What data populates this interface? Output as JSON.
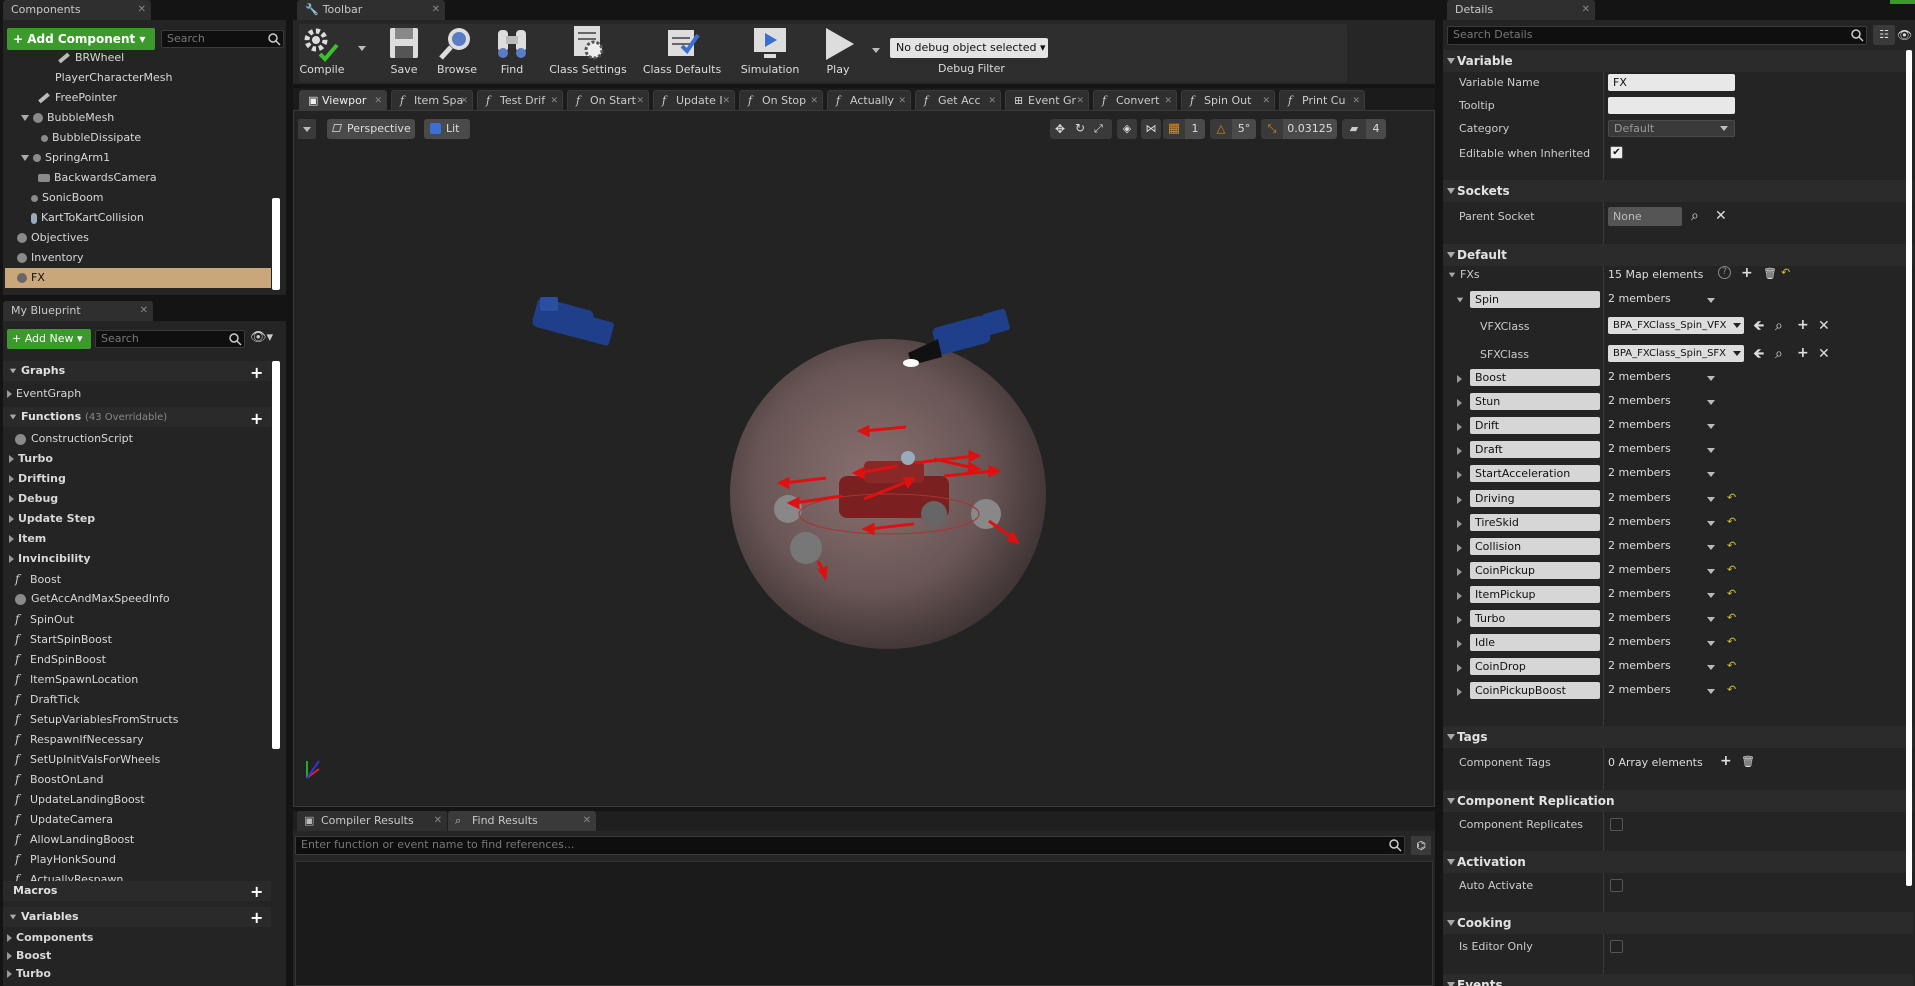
{
  "components": {
    "tab_title": "Components",
    "add_component_label": "+ Add Component ▾",
    "search_placeholder": "Search",
    "items": [
      {
        "label": "BRWheel"
      },
      {
        "label": "PlayerCharacterMesh"
      },
      {
        "label": "FreePointer"
      },
      {
        "label": "BubbleMesh"
      },
      {
        "label": "BubbleDissipate"
      },
      {
        "label": "SpringArm1"
      },
      {
        "label": "BackwardsCamera"
      },
      {
        "label": "SonicBoom"
      },
      {
        "label": "KartToKartCollision"
      },
      {
        "label": "Objectives"
      },
      {
        "label": "Inventory"
      },
      {
        "label": "FX"
      }
    ]
  },
  "my_blueprint": {
    "tab_title": "My Blueprint",
    "add_new_label": "+ Add New ▾",
    "search_placeholder": "Search",
    "graphs_label": "Graphs",
    "event_graph": "EventGraph",
    "functions_label": "Functions",
    "functions_overridable": "(43 Overridable)",
    "functions": [
      {
        "label": "ConstructionScript",
        "kind": "construct"
      },
      {
        "label": "Turbo",
        "kind": "category"
      },
      {
        "label": "Drifting",
        "kind": "category"
      },
      {
        "label": "Debug",
        "kind": "category"
      },
      {
        "label": "Update Step",
        "kind": "category"
      },
      {
        "label": "Item",
        "kind": "category"
      },
      {
        "label": "Invincibility",
        "kind": "category"
      },
      {
        "label": "Boost",
        "kind": "fn"
      },
      {
        "label": "GetAccAndMaxSpeedInfo",
        "kind": "construct"
      },
      {
        "label": "SpinOut",
        "kind": "fn"
      },
      {
        "label": "StartSpinBoost",
        "kind": "fn"
      },
      {
        "label": "EndSpinBoost",
        "kind": "fn"
      },
      {
        "label": "ItemSpawnLocation",
        "kind": "fn"
      },
      {
        "label": "DraftTick",
        "kind": "fn"
      },
      {
        "label": "SetupVariablesFromStructs",
        "kind": "fn"
      },
      {
        "label": "RespawnIfNecessary",
        "kind": "fn"
      },
      {
        "label": "SetUpInitValsForWheels",
        "kind": "fn"
      },
      {
        "label": "BoostOnLand",
        "kind": "fn"
      },
      {
        "label": "UpdateLandingBoost",
        "kind": "fn"
      },
      {
        "label": "UpdateCamera",
        "kind": "fn"
      },
      {
        "label": "AllowLandingBoost",
        "kind": "fn"
      },
      {
        "label": "PlayHonkSound",
        "kind": "fn"
      },
      {
        "label": "ActuallyRespawn",
        "kind": "fn"
      }
    ],
    "macros_label": "Macros",
    "variables_label": "Variables",
    "variable_categories": [
      "Components",
      "Boost",
      "Turbo"
    ]
  },
  "toolbar": {
    "tab_title": "Toolbar",
    "buttons": [
      {
        "label": "Compile",
        "icon": "gear-check-icon"
      },
      {
        "label": "Save",
        "icon": "save-icon"
      },
      {
        "label": "Browse",
        "icon": "magnifier-icon"
      },
      {
        "label": "Find",
        "icon": "binoculars-icon"
      },
      {
        "label": "Class Settings",
        "icon": "class-settings-icon"
      },
      {
        "label": "Class Defaults",
        "icon": "class-defaults-icon"
      },
      {
        "label": "Simulation",
        "icon": "simulation-icon"
      },
      {
        "label": "Play",
        "icon": "play-icon"
      }
    ],
    "debug_select": "No debug object selected ▾",
    "debug_filter_label": "Debug Filter"
  },
  "editor_tabs": [
    {
      "label": "Viewpor",
      "active": true,
      "icon": "viewport"
    },
    {
      "label": "Item Spa",
      "icon": "f"
    },
    {
      "label": "Test Drif",
      "icon": "f"
    },
    {
      "label": "On Start",
      "icon": "f"
    },
    {
      "label": "Update I",
      "icon": "f"
    },
    {
      "label": "On Stop",
      "icon": "f"
    },
    {
      "label": "Actually",
      "icon": "f"
    },
    {
      "label": "Get Acc",
      "icon": "f"
    },
    {
      "label": "Event Gr",
      "icon": "graph"
    },
    {
      "label": "Convert",
      "icon": "f"
    },
    {
      "label": "Spin Out",
      "icon": "f"
    },
    {
      "label": "Print Cu",
      "icon": "f"
    }
  ],
  "viewport": {
    "perspective_label": "Perspective",
    "lit_label": "Lit",
    "grid_snap": "1",
    "rotation_snap": "5°",
    "scale_snap": "0.03125",
    "camera_speed": "4"
  },
  "bottom": {
    "tabs": [
      "Compiler Results",
      "Find Results"
    ],
    "find_placeholder": "Enter function or event name to find references..."
  },
  "details": {
    "tab_title": "Details",
    "search_placeholder": "Search Details",
    "sections": {
      "variable": "Variable",
      "sockets": "Sockets",
      "default": "Default",
      "tags": "Tags",
      "replication": "Component Replication",
      "activation": "Activation",
      "cooking": "Cooking",
      "events": "Events"
    },
    "variable_name_label": "Variable Name",
    "variable_name_value": "FX",
    "tooltip_label": "Tooltip",
    "tooltip_value": "",
    "category_label": "Category",
    "category_value": "Default",
    "editable_label": "Editable when Inherited",
    "parent_socket_label": "Parent Socket",
    "parent_socket_value": "None",
    "fxs_label": "FXs",
    "fxs_value": "15 Map elements",
    "spin_key": "Spin",
    "spin_members": "2 members",
    "vfx_label": "VFXClass",
    "vfx_value": "BPA_FXClass_Spin_VFX",
    "sfx_label": "SFXClass",
    "sfx_value": "BPA_FXClass_Spin_SFX",
    "map_rows": [
      {
        "key": "Boost",
        "members": "2 members",
        "reset": false
      },
      {
        "key": "Stun",
        "members": "2 members",
        "reset": false
      },
      {
        "key": "Drift",
        "members": "2 members",
        "reset": false
      },
      {
        "key": "Draft",
        "members": "2 members",
        "reset": false
      },
      {
        "key": "StartAcceleration",
        "members": "2 members",
        "reset": false
      },
      {
        "key": "Driving",
        "members": "2 members",
        "reset": true
      },
      {
        "key": "TireSkid",
        "members": "2 members",
        "reset": true
      },
      {
        "key": "Collision",
        "members": "2 members",
        "reset": true
      },
      {
        "key": "CoinPickup",
        "members": "2 members",
        "reset": true
      },
      {
        "key": "ItemPickup",
        "members": "2 members",
        "reset": true
      },
      {
        "key": "Turbo",
        "members": "2 members",
        "reset": true
      },
      {
        "key": "Idle",
        "members": "2 members",
        "reset": true
      },
      {
        "key": "CoinDrop",
        "members": "2 members",
        "reset": true
      },
      {
        "key": "CoinPickupBoost",
        "members": "2 members",
        "reset": true
      }
    ],
    "component_tags_label": "Component Tags",
    "component_tags_value": "0 Array elements",
    "component_replicates_label": "Component Replicates",
    "auto_activate_label": "Auto Activate",
    "is_editor_only_label": "Is Editor Only"
  }
}
